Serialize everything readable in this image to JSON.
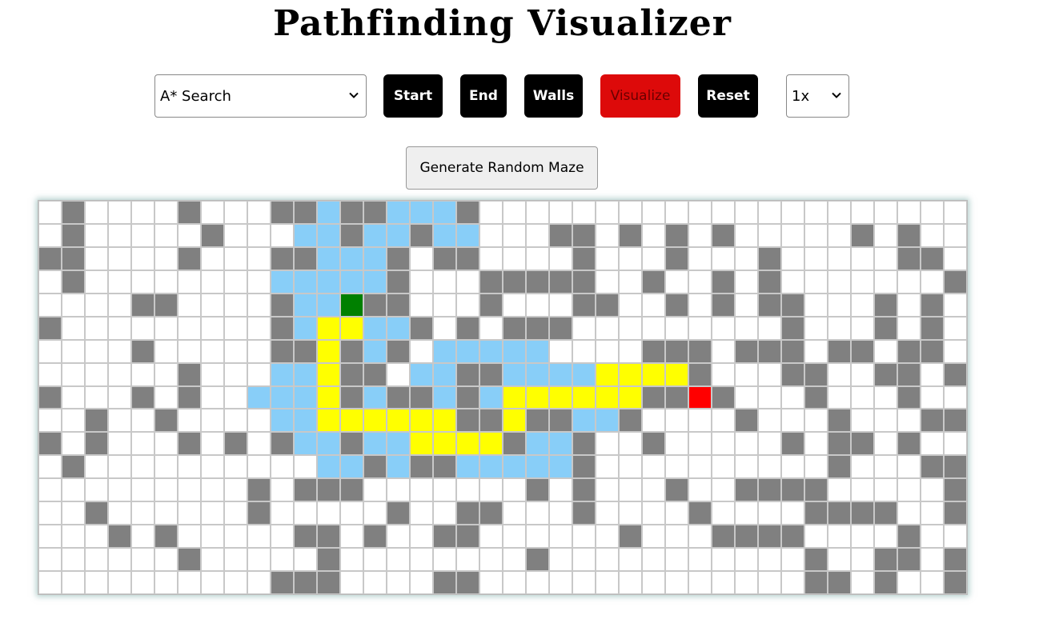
{
  "app": {
    "title": "Pathfinding Visualizer"
  },
  "toolbar": {
    "algorithm_selected": "A* Search",
    "start_label": "Start",
    "end_label": "End",
    "walls_label": "Walls",
    "visualize_label": "Visualize",
    "reset_label": "Reset",
    "speed_selected": "1x",
    "maze_label": "Generate Random Maze"
  },
  "colors": {
    "wall": "#808080",
    "visited": "#88cef8",
    "path": "#ffff00",
    "start": "#008000",
    "end": "#ff0000",
    "visualize_button": "#dd0a0a"
  },
  "grid": {
    "columns": 40,
    "legend": {
      "#": "wall",
      "v": "visited",
      "y": "path",
      "S": "start",
      "E": "end",
      ".": "empty"
    },
    "rows": [
      ".#....#...##v##vvv#.....................",
      ".#.....#...vv#vv#vv...##.#.#.#.....#.#..",
      "##....#...##vvv#.##....#...#...#.....##.",
      ".#........vvvvv#...#####..#..#.#.......#",
      "....##....#vvS##...#...##..#.#.##...#.#.",
      "#.........#vyyvv#.#.###.........#...#.#.",
      "....#.....##y#v#.vvvvv....###.###.##.##.",
      "......#...vvy##.vv##vvvvyyyy#...##..##.#",
      "#...#.#..vvvy#v##v#vyyyyyy##E#...#...#..",
      "..#..#....vvyyyyyy##y##vv#....#...#...##",
      "#.#...#.#.#vv#vvyyyy#vv#..#.....#.##.#..",
      ".#..........vv#v##vvvvv#..........#...##",
      ".........#.###.......#.#...#..####.....#",
      "..#......#.....#..##...#....#....####..#",
      "...#.#.....##.#..##......#...####....#..",
      "......#.....#........#...........#..##.#",
      "..........###....##..............##.#..#"
    ]
  }
}
